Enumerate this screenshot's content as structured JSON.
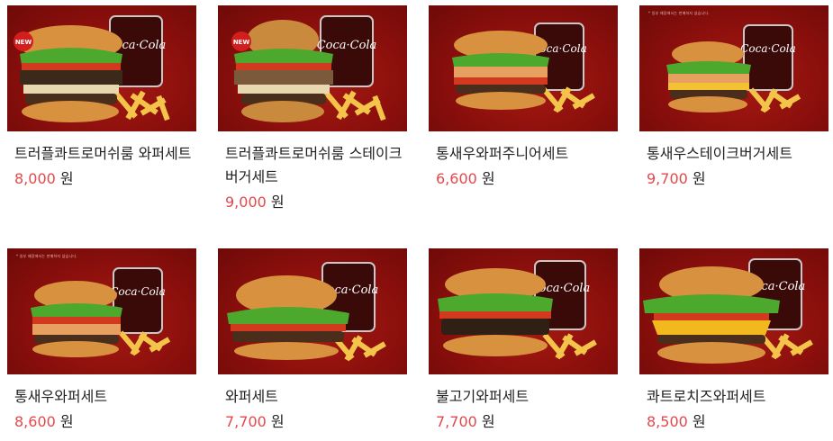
{
  "colors": {
    "price": "#e3494b",
    "card_bg": "#8d1010"
  },
  "products": [
    {
      "name": "트러플콰트로머쉬룸 와퍼세트",
      "price": "8,000",
      "currency": "원",
      "badge": "NEW",
      "notice": "",
      "image_icon": "truffle-burger-set-image"
    },
    {
      "name": "트러플콰트로머쉬룸 스테이크버거세트",
      "price": "9,000",
      "currency": "원",
      "badge": "NEW",
      "notice": "",
      "image_icon": "truffle-steak-burger-set-image"
    },
    {
      "name": "통새우와퍼주니어세트",
      "price": "6,600",
      "currency": "원",
      "badge": "",
      "notice": "",
      "image_icon": "shrimp-whopper-jr-set-image"
    },
    {
      "name": "통새우스테이크버거세트",
      "price": "9,700",
      "currency": "원",
      "badge": "",
      "notice": "* 일부 매장에서는 판매하지 않습니다.",
      "image_icon": "shrimp-steak-burger-set-image"
    },
    {
      "name": "통새우와퍼세트",
      "price": "8,600",
      "currency": "원",
      "badge": "",
      "notice": "* 일부 매장에서는 판매하지 않습니다.",
      "image_icon": "shrimp-whopper-set-image"
    },
    {
      "name": "와퍼세트",
      "price": "7,700",
      "currency": "원",
      "badge": "",
      "notice": "",
      "image_icon": "whopper-set-image"
    },
    {
      "name": "불고기와퍼세트",
      "price": "7,700",
      "currency": "원",
      "badge": "",
      "notice": "",
      "image_icon": "bulgogi-whopper-set-image"
    },
    {
      "name": "콰트로치즈와퍼세트",
      "price": "8,500",
      "currency": "원",
      "badge": "",
      "notice": "",
      "image_icon": "quattro-cheese-whopper-set-image"
    }
  ]
}
